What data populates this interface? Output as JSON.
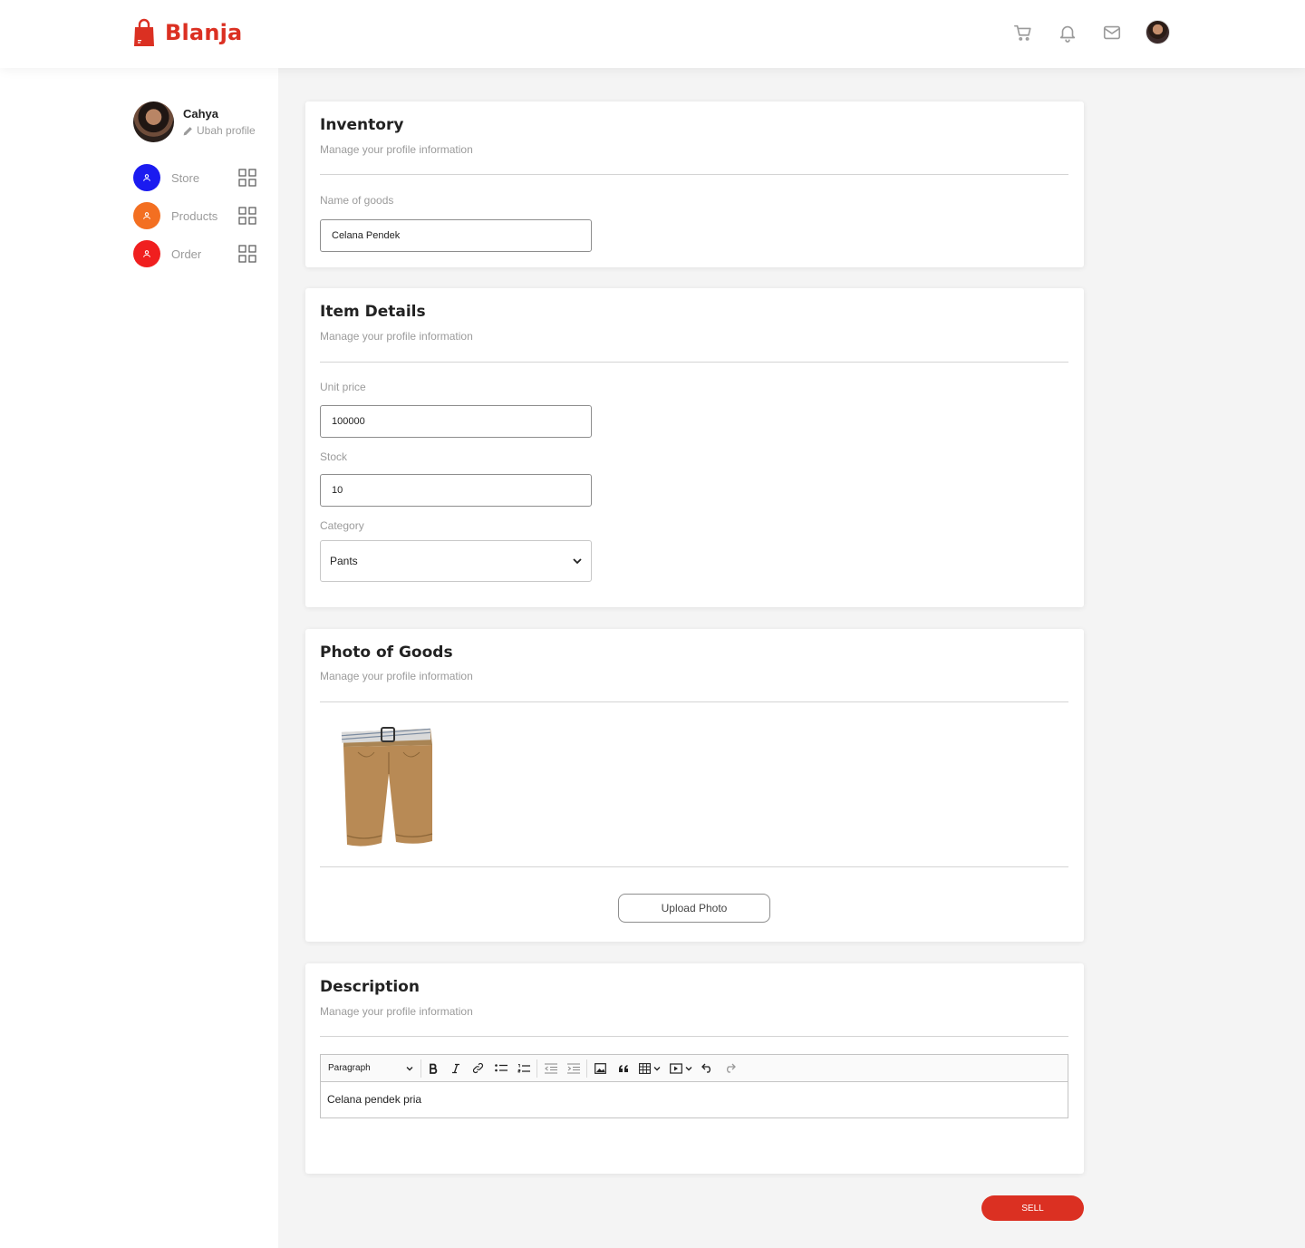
{
  "brand": {
    "name": "Blanja",
    "color": "#DB3022"
  },
  "header": {
    "icons": [
      "cart-icon",
      "bell-icon",
      "mail-icon",
      "user-avatar"
    ]
  },
  "sidebar": {
    "user_name": "Cahya",
    "edit_label": "Ubah profile",
    "items": [
      {
        "label": "Store",
        "color": "#1b1bf0"
      },
      {
        "label": "Products",
        "color": "#F36F21"
      },
      {
        "label": "Order",
        "color": "#F01F1F"
      }
    ]
  },
  "inventory": {
    "title": "Inventory",
    "subtitle": "Manage your profile information",
    "name_label": "Name of goods",
    "name_value": "Celana Pendek"
  },
  "item_details": {
    "title": "Item Details",
    "subtitle": "Manage your profile information",
    "price_label": "Unit price",
    "price_value": "100000",
    "stock_label": "Stock",
    "stock_value": "10",
    "category_label": "Category",
    "category_value": "Pants"
  },
  "photo": {
    "title": "Photo of Goods",
    "subtitle": "Manage your profile information",
    "upload_label": "Upload Photo"
  },
  "description": {
    "title": "Description",
    "subtitle": "Manage your profile information",
    "format_value": "Paragraph",
    "body": "Celana pendek pria"
  },
  "sell_label": "SELL"
}
